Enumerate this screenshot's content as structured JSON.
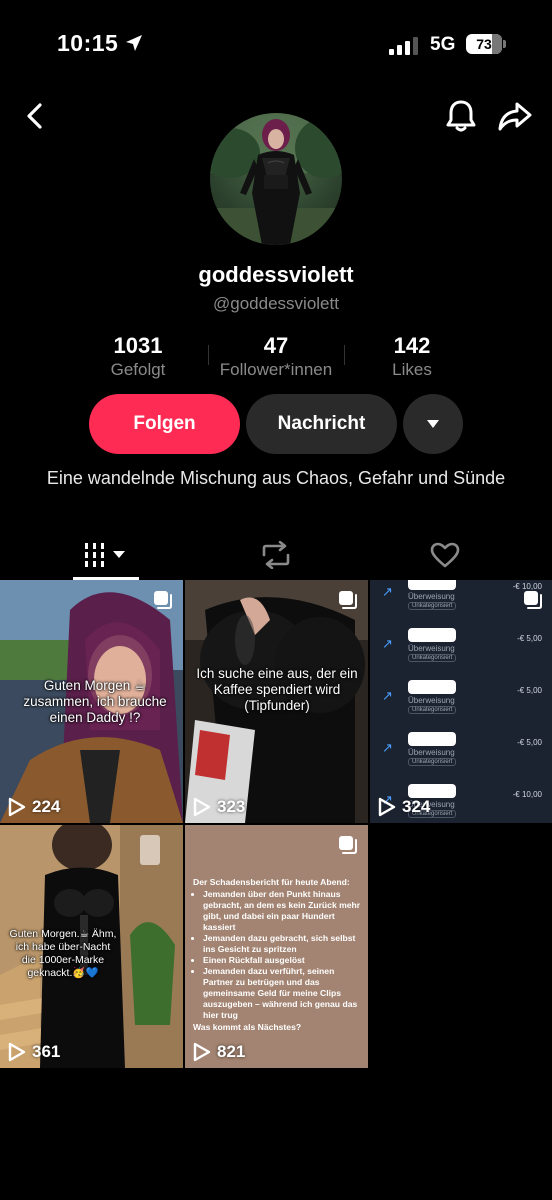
{
  "status_bar": {
    "time": "10:15",
    "network": "5G",
    "battery": "73",
    "battery_level": 0.73
  },
  "profile": {
    "display_name": "goddessviolett",
    "handle": "@goddessviolett",
    "bio": "Eine wandelnde Mischung aus Chaos, Gefahr und Sünde"
  },
  "stats": {
    "following": {
      "value": "1031",
      "label": "Gefolgt"
    },
    "followers": {
      "value": "47",
      "label": "Follower*innen"
    },
    "likes": {
      "value": "142",
      "label": "Likes"
    }
  },
  "actions": {
    "follow_label": "Folgen",
    "message_label": "Nachricht"
  },
  "tabs": [
    {
      "name": "videos",
      "icon": "grid-icon",
      "active": true
    },
    {
      "name": "reposts",
      "icon": "repost-icon",
      "active": false
    },
    {
      "name": "liked",
      "icon": "heart-icon",
      "active": false
    }
  ],
  "colors": {
    "accent": "#fe2c55",
    "background": "#000000",
    "button_secondary": "#2a2a2a",
    "muted_text": "#8a8a8a"
  },
  "videos": [
    {
      "caption": "Guten Morgen ☕ zusammen, ich brauche einen Daddy !?",
      "views": "224",
      "multi": true
    },
    {
      "caption": "Ich suche eine aus, der ein Kaffee spendiert wird (Tipfunder)",
      "views": "323",
      "multi": true
    },
    {
      "views": "324",
      "multi": true,
      "ledger": [
        {
          "sub": "Überweisung",
          "tag": "Unkategorisiert",
          "amount": "-€ 10,00"
        },
        {
          "sub": "Überweisung",
          "tag": "Unkategorisiert",
          "amount": "-€ 5,00"
        },
        {
          "sub": "Überweisung",
          "tag": "Unkategorisiert",
          "amount": "-€ 5,00"
        },
        {
          "sub": "Überweisung",
          "tag": "Unkategorisiert",
          "amount": "-€ 5,00"
        },
        {
          "sub": "Überweisung",
          "tag": "Unkategorisiert",
          "amount": "-€ 10,00"
        }
      ]
    },
    {
      "caption": "Guten Morgen.☕ Ähm, ich habe über-Nacht die 1000er-Marke geknackt.🥳💙",
      "views": "361",
      "multi": false
    },
    {
      "views": "821",
      "multi": true,
      "report_title": "Der Schadensbericht für heute Abend:",
      "report_items": [
        "Jemanden über den Punkt hinaus gebracht, an dem es kein Zurück mehr gibt, und dabei ein paar Hundert kassiert",
        "Jemanden dazu gebracht, sich selbst ins Gesicht zu spritzen",
        "Einen Rückfall ausgelöst",
        "Jemanden dazu verführt, seinen Partner zu betrügen und das gemeinsame Geld für meine Clips auszugeben – während ich genau das hier trug"
      ],
      "report_footer": "Was kommt als Nächstes?"
    }
  ]
}
